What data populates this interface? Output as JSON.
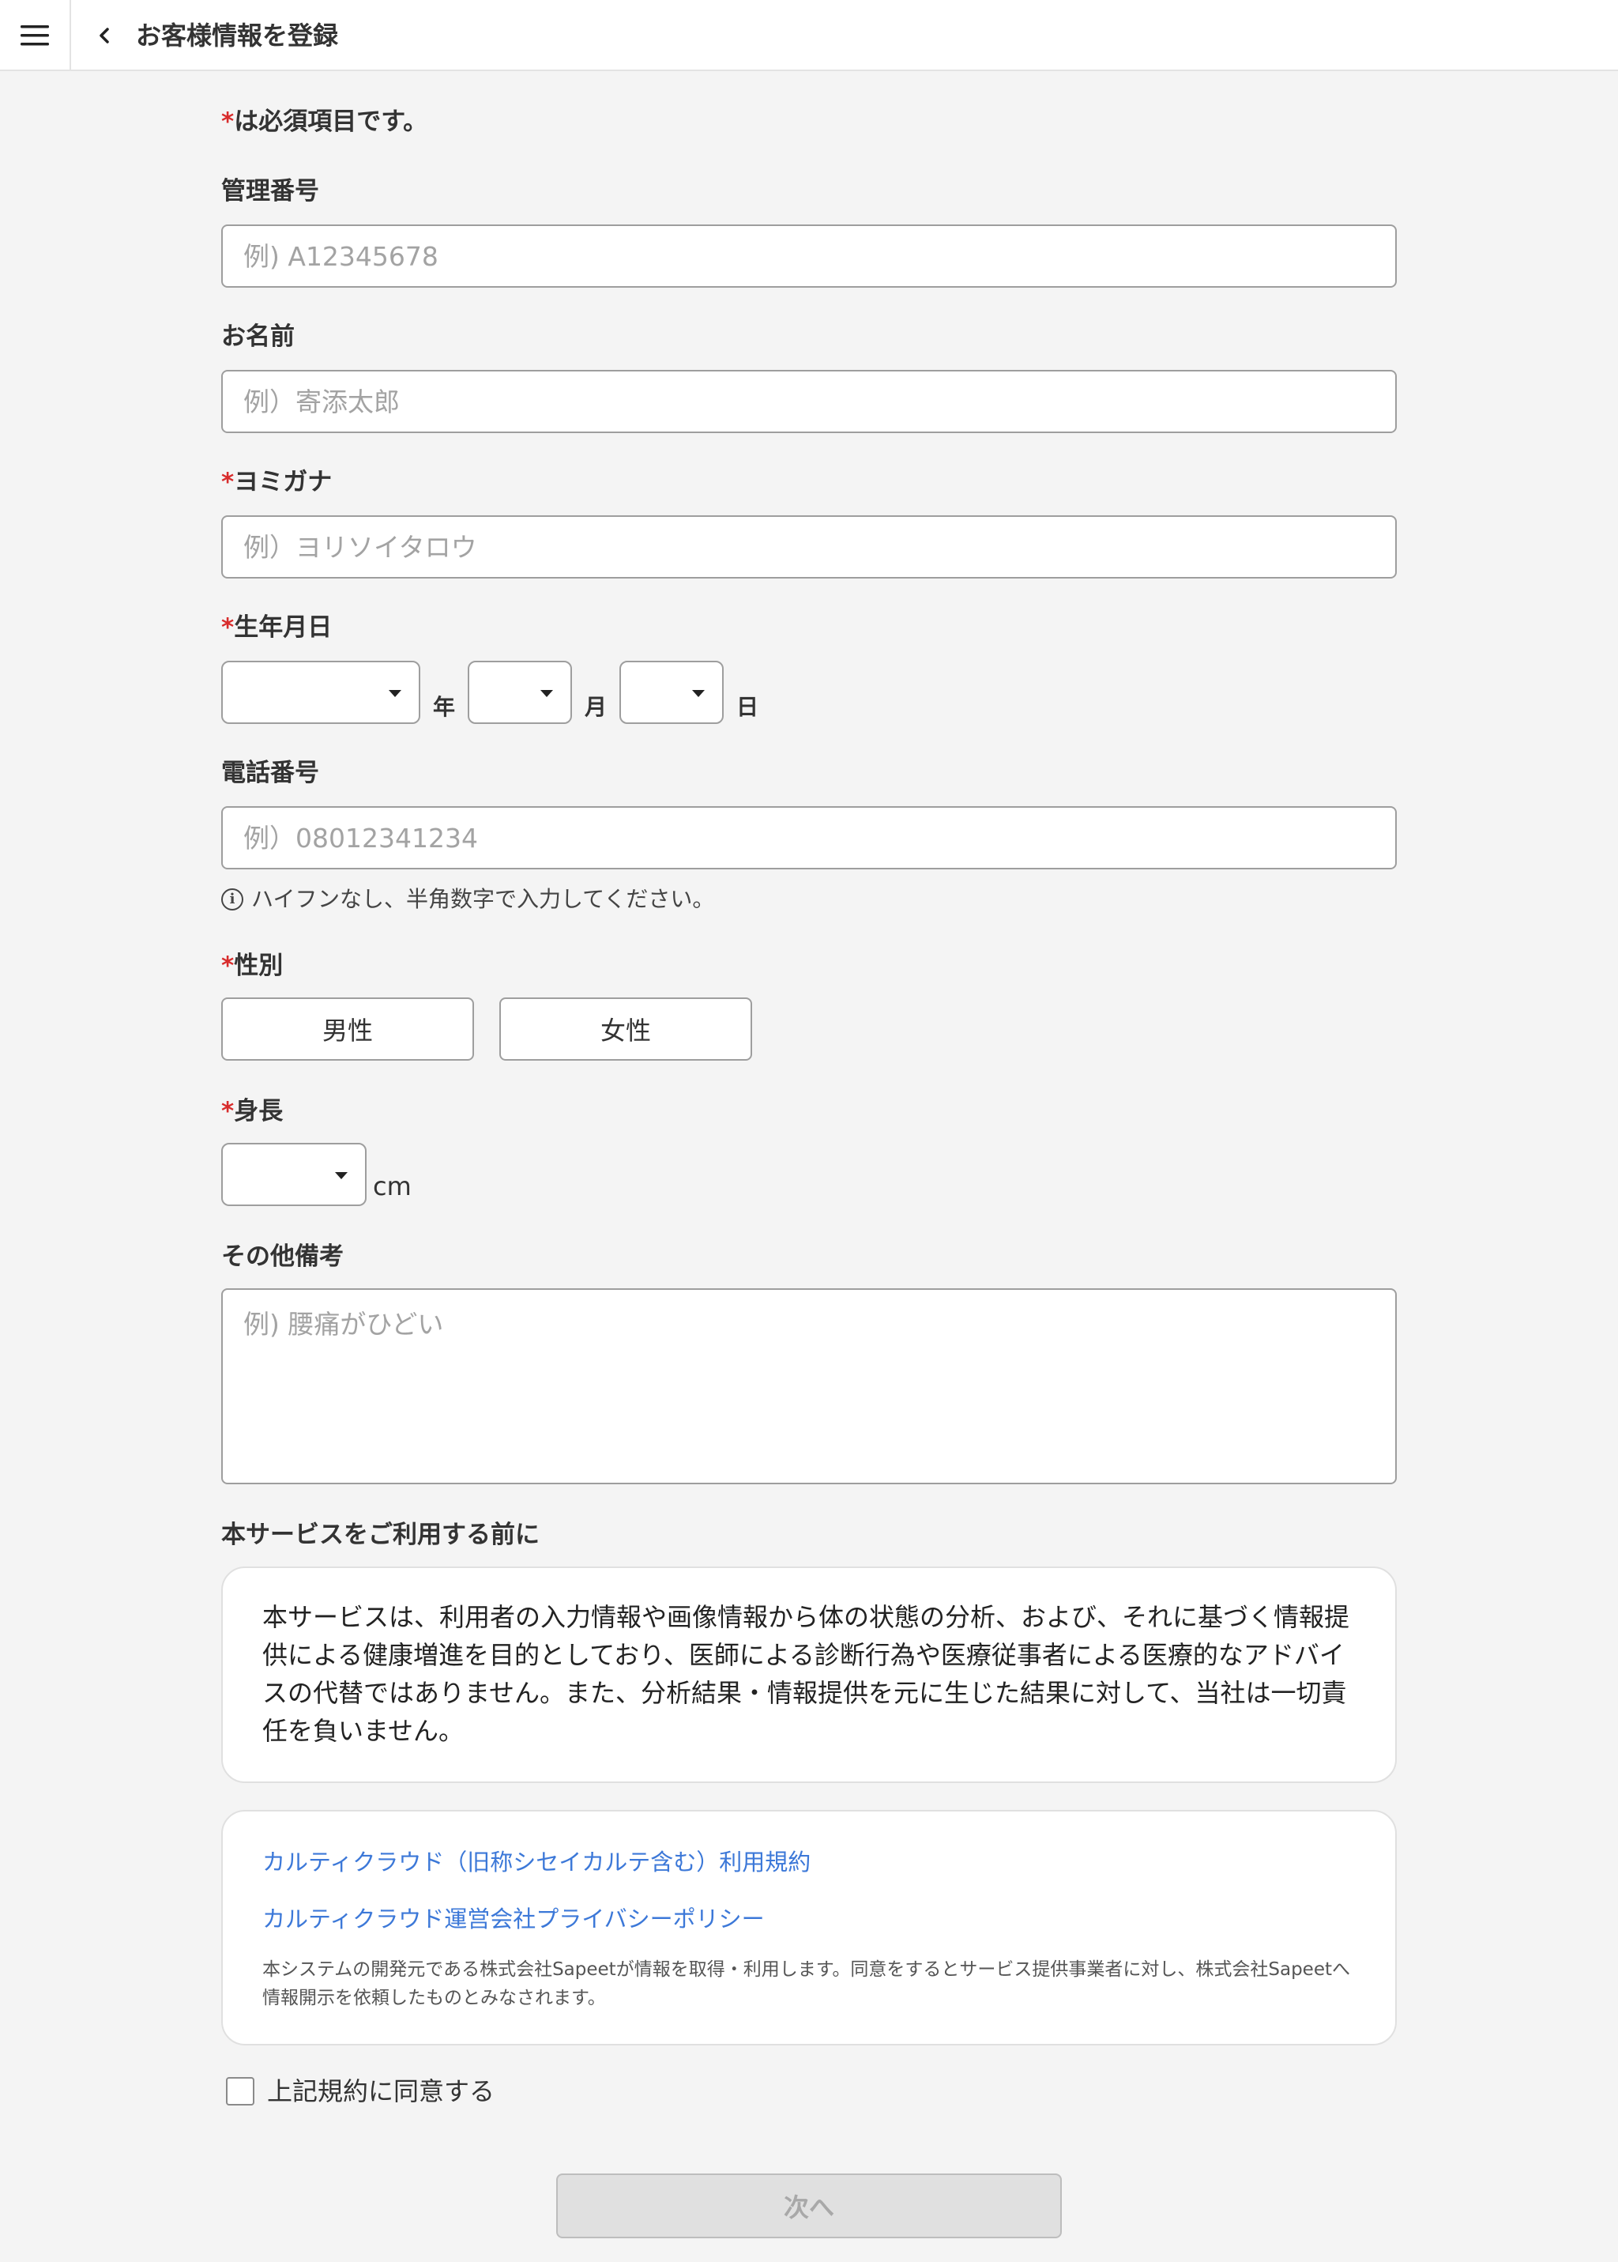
{
  "header": {
    "title": "お客様情報を登録"
  },
  "form": {
    "required_note": "は必須項目です。",
    "required_mark": "*",
    "management_number": {
      "label": "管理番号",
      "placeholder": "例) A12345678",
      "value": ""
    },
    "name": {
      "label": "お名前",
      "placeholder": "例）寄添太郎",
      "value": ""
    },
    "kana": {
      "label": "ヨミガナ",
      "placeholder": "例）ヨリソイタロウ",
      "value": ""
    },
    "birthdate": {
      "label": "生年月日",
      "year_unit": "年",
      "month_unit": "月",
      "day_unit": "日",
      "year_value": "",
      "month_value": "",
      "day_value": ""
    },
    "phone": {
      "label": "電話番号",
      "placeholder": "例）08012341234",
      "value": "",
      "hint": "ハイフンなし、半角数字で入力してください。"
    },
    "gender": {
      "label": "性別",
      "options": [
        "男性",
        "女性"
      ]
    },
    "height": {
      "label": "身長",
      "unit": "cm",
      "value": ""
    },
    "notes": {
      "label": "その他備考",
      "placeholder": "例) 腰痛がひどい",
      "value": ""
    }
  },
  "notice": {
    "heading": "本サービスをご利用する前に",
    "text": "本サービスは、利用者の入力情報や画像情報から体の状態の分析、および、それに基づく情報提供による健康増進を目的としており、医師による診断行為や医療従事者による医療的なアドバイスの代替ではありません。また、分析結果・情報提供を元に生じた結果に対して、当社は一切責任を負いません。"
  },
  "terms": {
    "link_terms": "カルティクラウド（旧称シセイカルテ含む）利用規約",
    "link_privacy": "カルティクラウド運営会社プライバシーポリシー",
    "disclaimer": "本システムの開発元である株式会社Sapeetが情報を取得・利用します。同意をするとサービス提供事業者に対し、株式会社Sapeetへ情報開示を依頼したものとみなされます。"
  },
  "agree": {
    "label": "上記規約に同意する",
    "checked": false
  },
  "next_button": {
    "label": "次へ",
    "enabled": false
  },
  "icons": {
    "menu": "hamburger-menu-icon",
    "back": "chevron-left-icon",
    "info": "info-circle-icon",
    "caret": "caret-down-icon"
  },
  "colors": {
    "required": "#d82c2c",
    "link": "#3c78d8",
    "background": "#f4f4f4",
    "button_disabled": "#e0e0e0"
  }
}
